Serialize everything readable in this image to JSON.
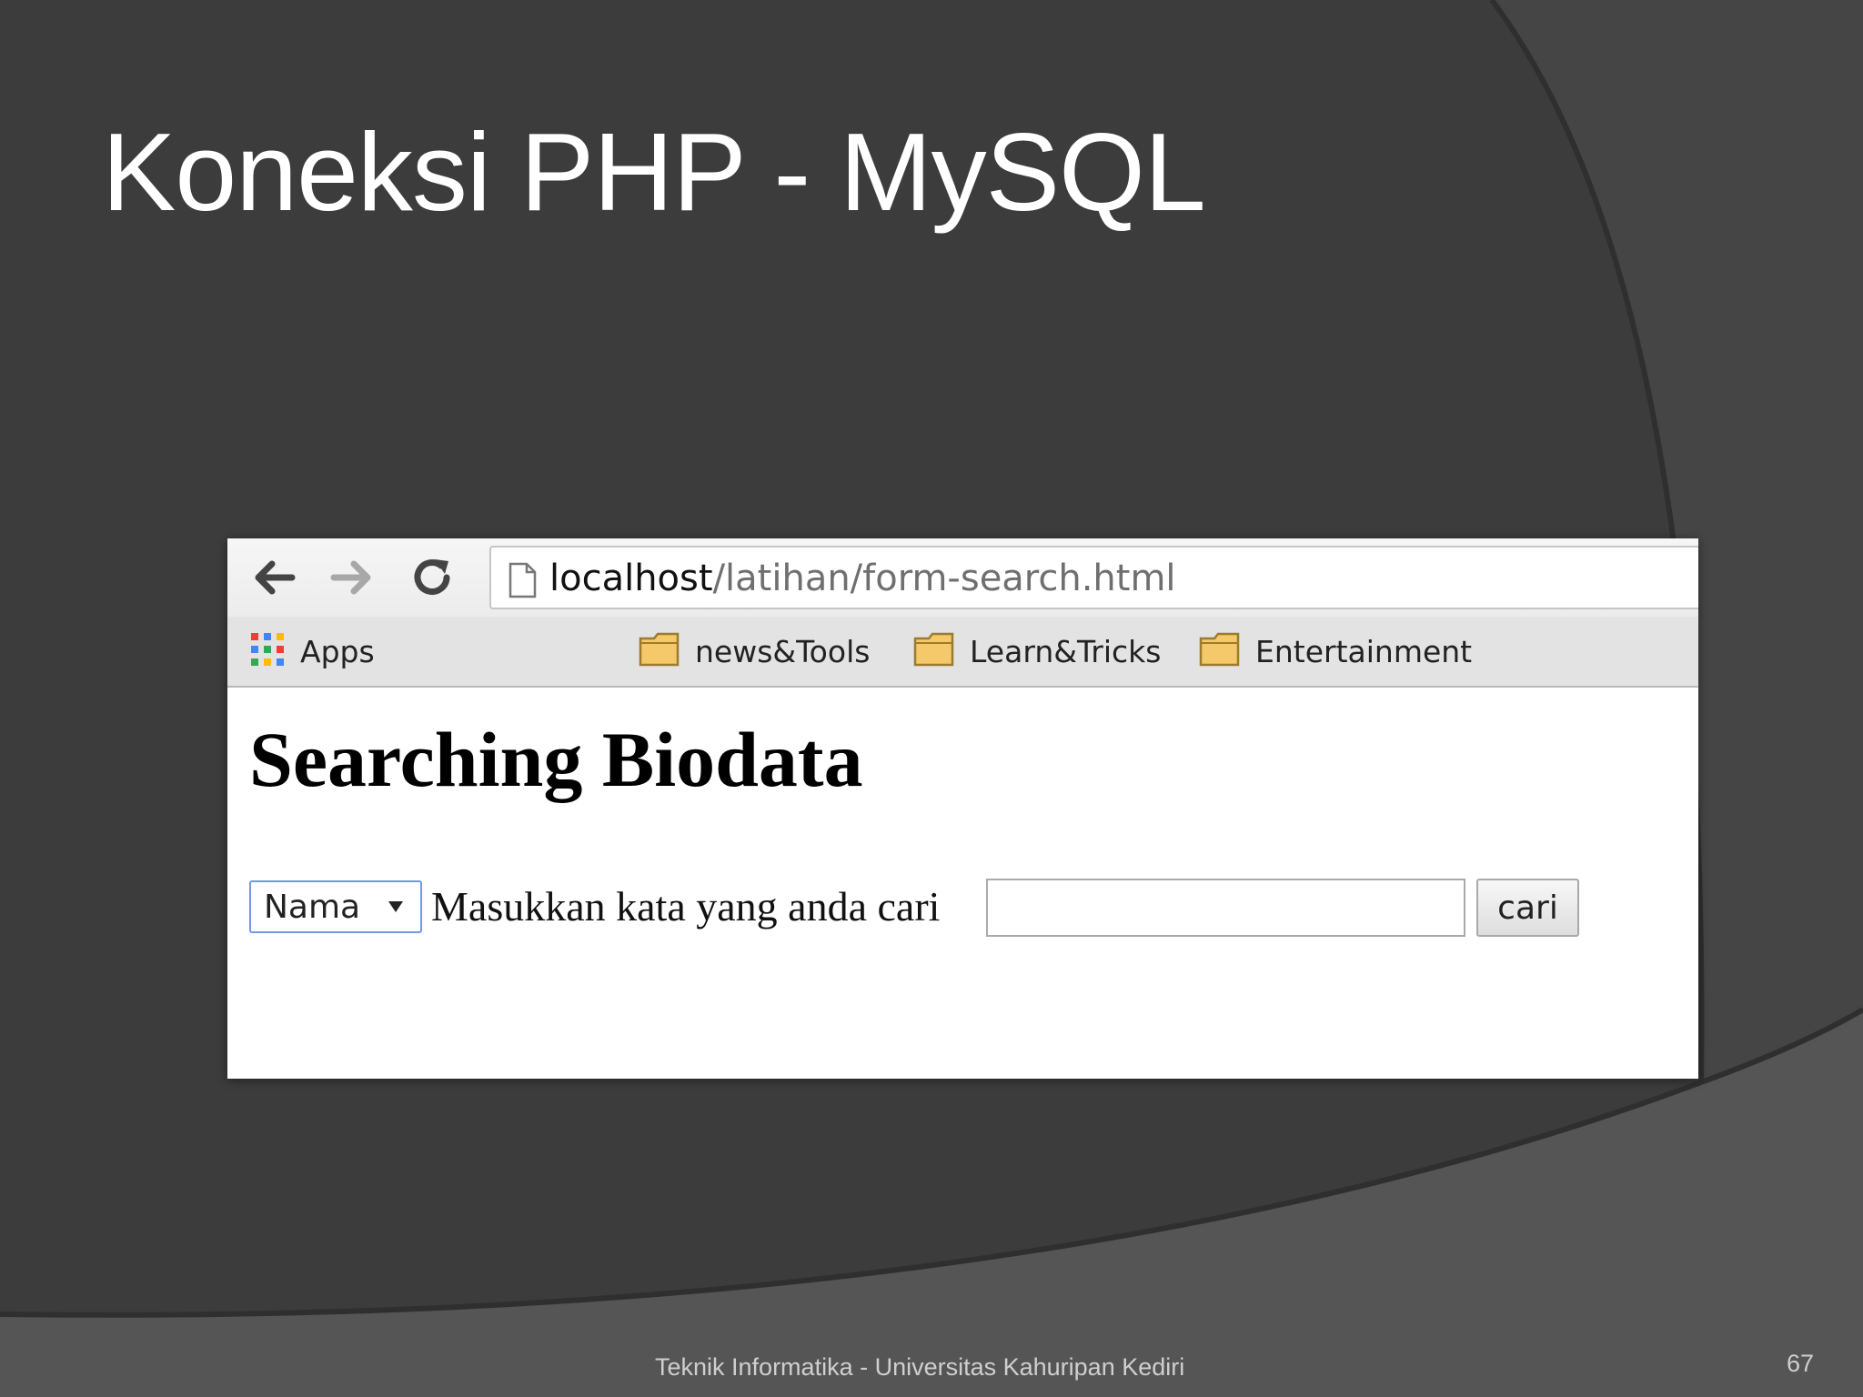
{
  "slide": {
    "title": "Koneksi PHP - MySQL",
    "footer": "Teknik Informatika - Universitas Kahuripan Kediri",
    "page_number": "67"
  },
  "browser": {
    "nav": {
      "back_icon": "arrow-left-icon",
      "forward_icon": "arrow-right-icon",
      "reload_icon": "reload-icon"
    },
    "url": {
      "host": "localhost",
      "path": "/latihan/form-search.html"
    },
    "bookmarks": [
      {
        "label": "Apps",
        "icon": "apps-grid-icon"
      },
      {
        "label": "news&Tools",
        "icon": "folder-icon"
      },
      {
        "label": "Learn&Tricks",
        "icon": "folder-icon"
      },
      {
        "label": "Entertainment",
        "icon": "folder-icon"
      }
    ]
  },
  "page": {
    "heading": "Searching Biodata",
    "select_value": "Nama",
    "search_label": "Masukkan kata yang anda cari",
    "search_value": "",
    "button_label": "cari"
  },
  "colors": {
    "slide_background": "#3c3c3c",
    "select_focus_border": "#6f9ae0",
    "folder_fill": "#f5c86a"
  }
}
